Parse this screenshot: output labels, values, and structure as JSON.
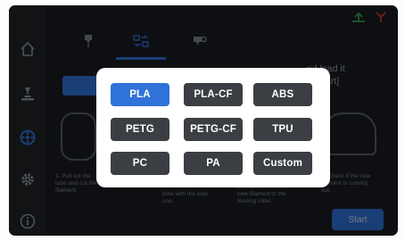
{
  "tabs": [
    {
      "name": "load-filament",
      "icon": "nozzle-down-icon"
    },
    {
      "name": "filament-type",
      "icon": "filament-swap-icon",
      "active": true
    },
    {
      "name": "unload-filament",
      "icon": "nozzle-fan-icon"
    }
  ],
  "sidebar": [
    {
      "icon": "home-icon"
    },
    {
      "icon": "print-bed-icon"
    },
    {
      "icon": "filament-spool-icon",
      "active": true
    },
    {
      "icon": "settings-gear-icon"
    },
    {
      "icon": "info-icon"
    }
  ],
  "wizard": {
    "title_fragment": "nd load it\nk [Start]",
    "captions": [
      "1. Pull out the\ntube and cut the\nfilament.",
      "tube with the new\none.",
      "extruded, insert the\nnew filament to the\nfeeding roller...",
      "4. Check if the new\nfilament is coming\nout."
    ],
    "start_label": "Start"
  },
  "material_popup": {
    "selected": "PLA",
    "options": [
      "PLA",
      "PLA-CF",
      "ABS",
      "PETG",
      "PETG-CF",
      "TPU",
      "PC",
      "PA",
      "Custom"
    ]
  },
  "colors": {
    "accent": "#2f72d8",
    "button": "#3b3e42",
    "background": "#1a1d21",
    "status_ok": "#3aa35a",
    "status_alert": "#d23b3b"
  }
}
